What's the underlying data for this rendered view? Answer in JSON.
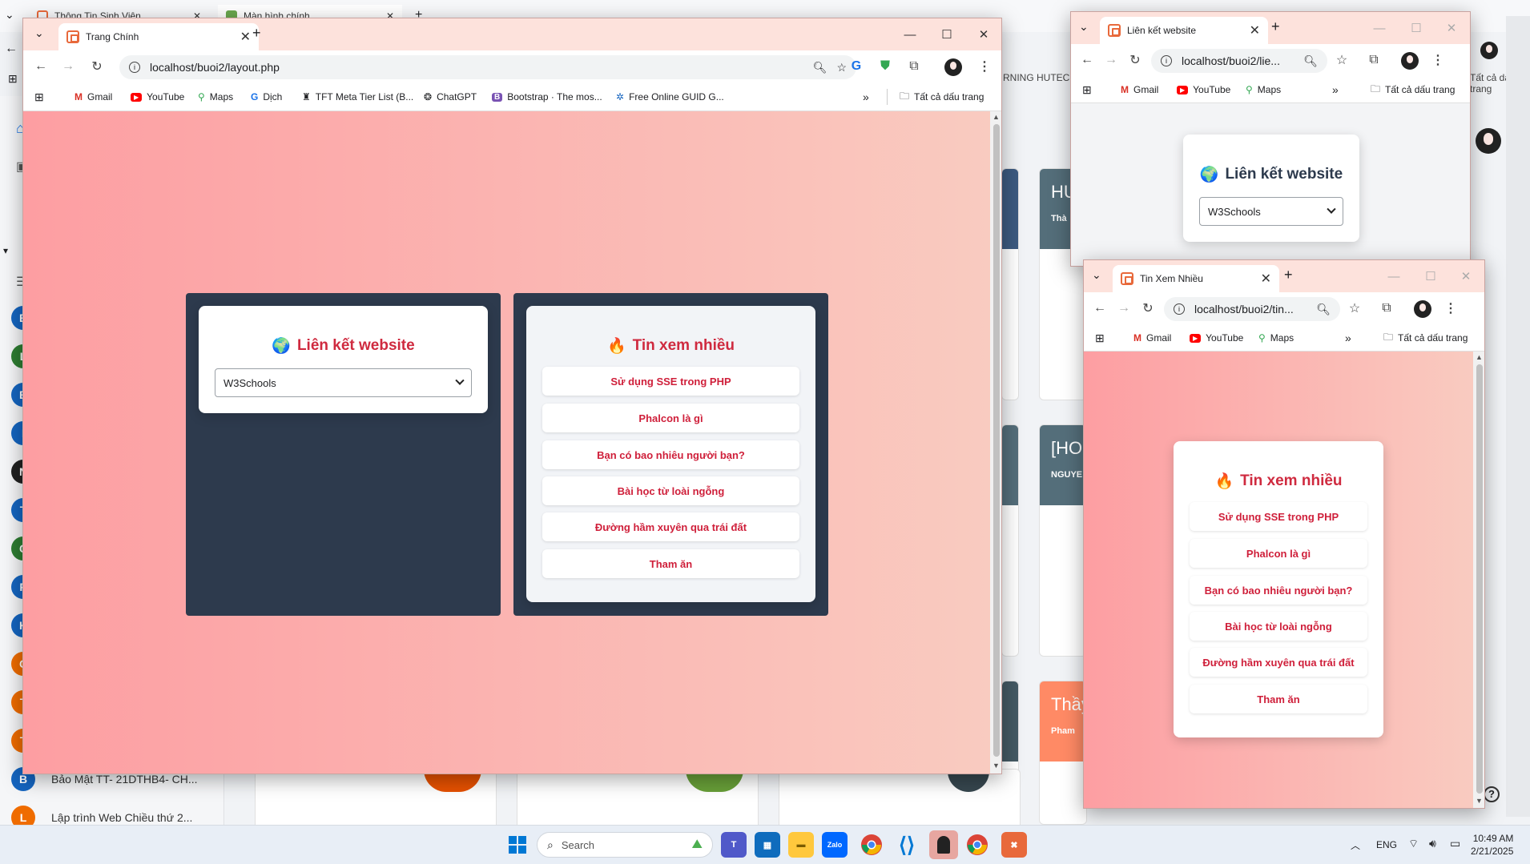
{
  "background_app": {
    "tabs": [
      "Thông Tin Sinh Viên",
      "Màn hình chính"
    ],
    "partial_text": "RNING HUTEC...",
    "right_label": "Tất cả dấu trang",
    "sidebar_items": [
      {
        "letter": "B",
        "text": "Bảo Mật TT- 21DTHB4- CH...",
        "color": "#1565c0"
      },
      {
        "letter": "L",
        "text": "Lập trình Web Chiều thứ 2...",
        "color": "#ef6c00"
      }
    ],
    "card_labels": [
      "HU",
      "Thà",
      "[HO",
      "NGUYE",
      "Thầy",
      "Pham"
    ]
  },
  "main_window": {
    "tab_title": "Trang Chính",
    "url": "localhost/buoi2/layout.php",
    "bookmarks": [
      "Gmail",
      "YouTube",
      "Maps",
      "Dịch",
      "TFT Meta Tier List (B...",
      "ChatGPT",
      "Bootstrap · The mos...",
      "Free Online GUID G..."
    ],
    "all_bookmarks": "Tất cả dấu trang",
    "links_widget": {
      "icon": "🌍",
      "title": "Liên kết website",
      "selected": "W3Schools"
    },
    "news_widget": {
      "icon": "🔥",
      "title": "Tin xem nhiều",
      "items": [
        "Sử dụng SSE trong PHP",
        "Phalcon là gì",
        "Bạn có bao nhiêu người bạn?",
        "Bài học từ loài ngỗng",
        "Đường hầm xuyên qua trái đất",
        "Tham ăn"
      ]
    }
  },
  "links_window": {
    "tab_title": "Liên kết website",
    "url": "localhost/buoi2/lie...",
    "bookmarks": [
      "Gmail",
      "YouTube",
      "Maps"
    ],
    "all_bookmarks": "Tất cả dấu trang",
    "widget": {
      "icon": "🌍",
      "title": "Liên kết website",
      "selected": "W3Schools"
    }
  },
  "news_window": {
    "tab_title": "Tin Xem Nhiều",
    "url": "localhost/buoi2/tin...",
    "bookmarks": [
      "Gmail",
      "YouTube",
      "Maps"
    ],
    "all_bookmarks": "Tất cả dấu trang",
    "widget": {
      "icon": "🔥",
      "title": "Tin xem nhiều",
      "items": [
        "Sử dụng SSE trong PHP",
        "Phalcon là gì",
        "Bạn có bao nhiêu người bạn?",
        "Bài học từ loài ngỗng",
        "Đường hầm xuyên qua trái đất",
        "Tham ăn"
      ]
    }
  },
  "taskbar": {
    "search": "Search",
    "lang": "ENG",
    "time": "10:49 AM",
    "date": "2/21/2025"
  },
  "colors": {
    "accent": "#cf2a3f",
    "panel": "#2d3a4d",
    "tabbar": "#fde2dc"
  }
}
